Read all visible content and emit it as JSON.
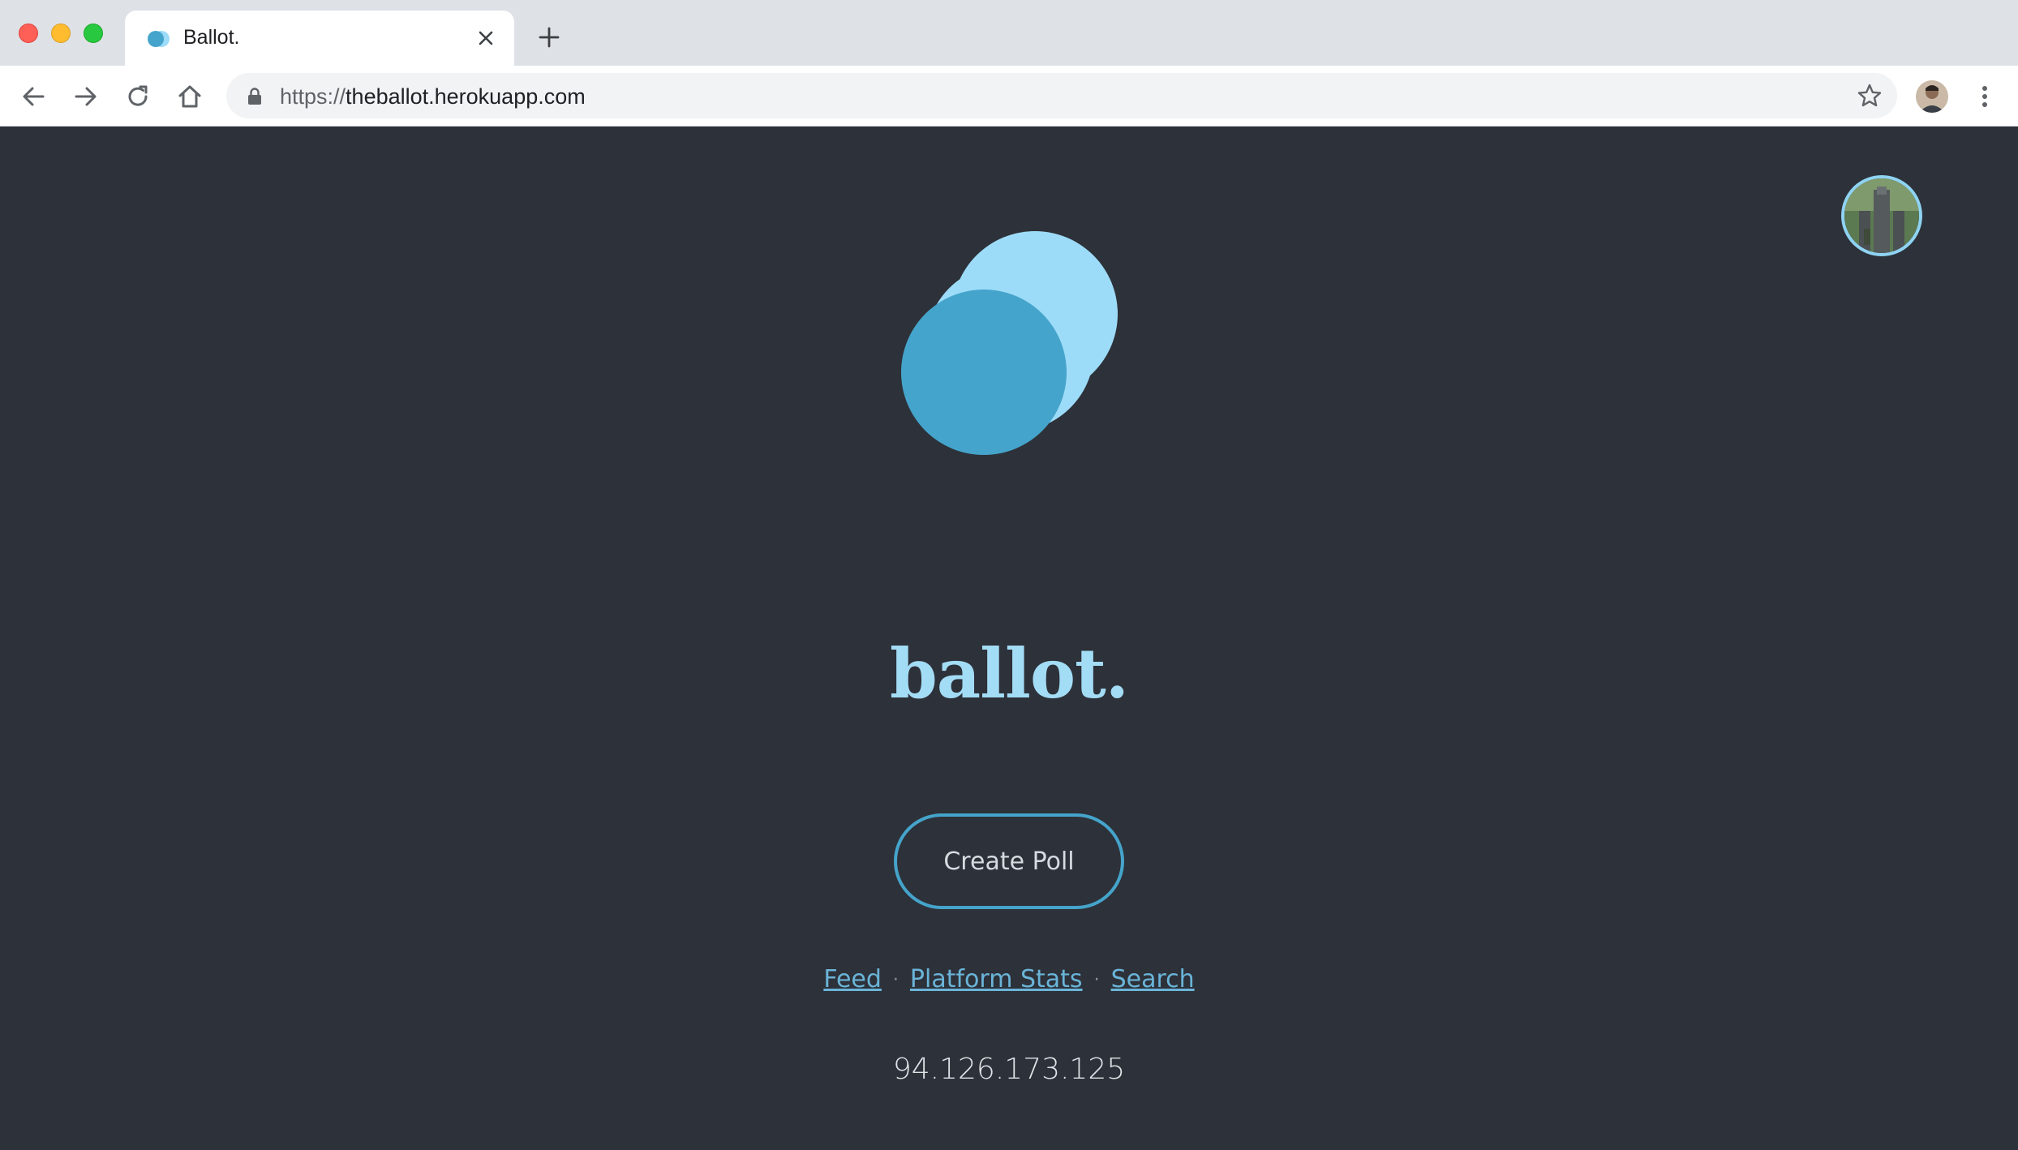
{
  "browser": {
    "tab_title": "Ballot.",
    "url_scheme": "https://",
    "url_host": "theballot.herokuapp.com"
  },
  "page": {
    "brand": "ballot.",
    "create_button": "Create Poll",
    "links": {
      "feed": "Feed",
      "stats": "Platform Stats",
      "search": "Search",
      "separator": "·"
    },
    "ip_address": "94.126.173.125"
  },
  "colors": {
    "background": "#2d3139",
    "logo_light": "#9ddcf8",
    "logo_dark": "#45a4cb",
    "brand_text": "#a3dcf5",
    "accent": "#45a4cb"
  },
  "icons": [
    "back-arrow-icon",
    "forward-arrow-icon",
    "reload-icon",
    "home-icon",
    "lock-icon",
    "star-icon",
    "menu-dots-icon",
    "close-icon",
    "plus-icon"
  ]
}
